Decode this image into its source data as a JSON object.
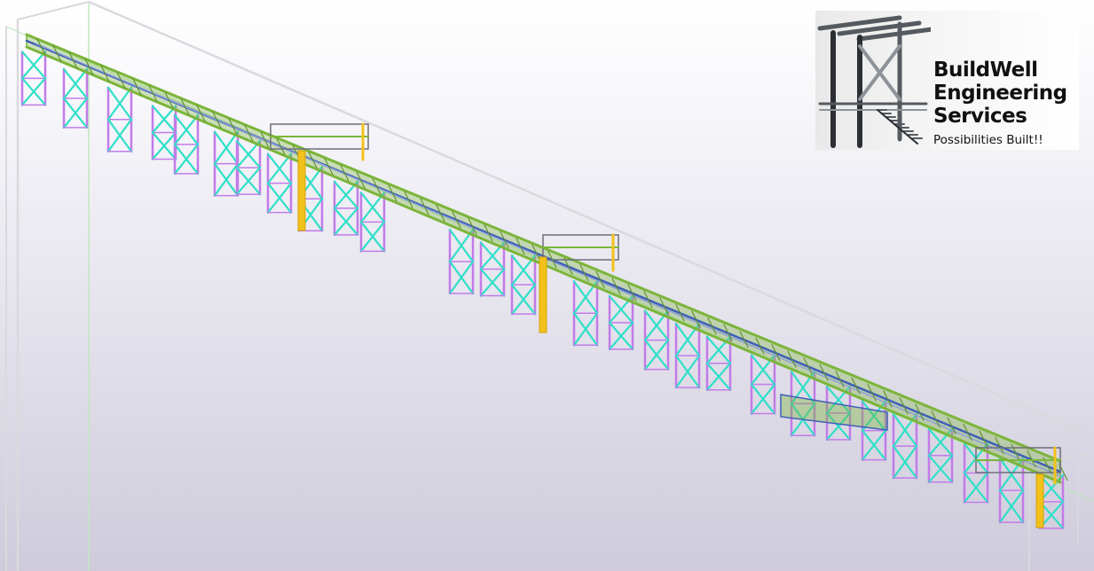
{
  "viewport": {
    "background_top": "#ffffff",
    "background_bottom": "#cfcbdb"
  },
  "model": {
    "colors": {
      "bracing": "#2fe0c8",
      "columns": "#c27be8",
      "deck": "#7bb53a",
      "conveyor": "#3f5fb8",
      "equipment": "#f2c21b",
      "boundary": "#d9d9de",
      "boundary_accent": "#bfe8bf"
    }
  },
  "logo": {
    "line1": "BuildWell",
    "line2": "Engineering",
    "line3": "Services",
    "tagline": "Possibilities Built!!",
    "text_color": "#111111",
    "icon": "steel-structure-icon"
  }
}
